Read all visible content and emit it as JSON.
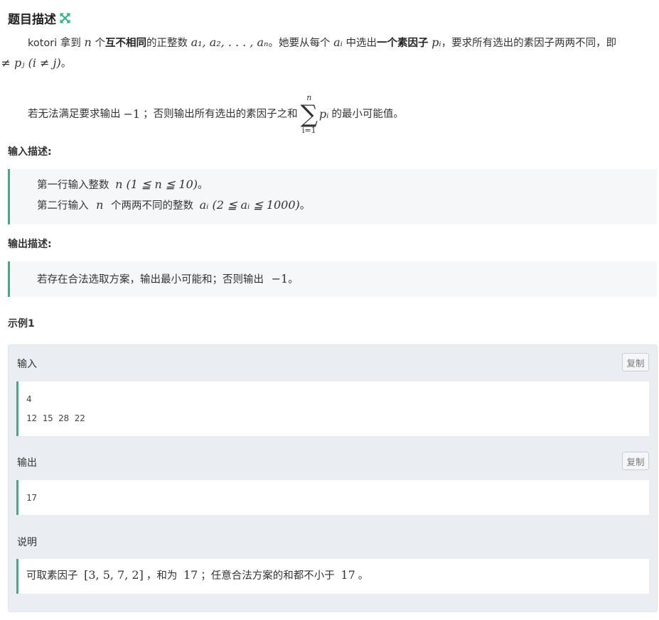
{
  "header": {
    "title": "题目描述",
    "icon": "expand-icon",
    "accent": "#2fb485"
  },
  "description": {
    "p1_intro": "kotori 拿到",
    "p1_n": "n",
    "p1_ge": " 个",
    "p1_bold1": "互不相同",
    "p1_mid": "的正整数",
    "p1_seq": "a₁, a₂, . . . , aₙ",
    "p1_after": "。她要从每个",
    "p1_ai": "aᵢ",
    "p1_mid2": " 中选出",
    "p1_bold2": "一个素因子",
    "p1_pi": "pᵢ",
    "p1_tail": "，要求所有选出的素因子两两不同，即",
    "p1_cond": "pᵢ ≠ pⱼ (i ≠ j)",
    "p1_end": "。",
    "p2_pre": "若无法满足要求输出",
    "p2_neg1": "−1",
    "p2_mid": "；否则输出所有选出的素因子之和",
    "sum_upper": "n",
    "sum_sigma": "∑",
    "sum_lower": "i=1",
    "sum_term": "pᵢ",
    "p2_end": "的最小可能值。"
  },
  "input_desc": {
    "label": "输入描述:",
    "line1_text": "第一行输入整数",
    "line1_math": "n (1 ≦ n ≦ 10)",
    "line1_end": "。",
    "line2_text": "第二行输入",
    "line2_n": "n",
    "line2_text2": "个两两不同的整数",
    "line2_math": "aᵢ (2 ≦ aᵢ ≦ 1000)",
    "line2_end": "。"
  },
  "output_desc": {
    "label": "输出描述:",
    "text": "若存在合法选取方案，输出最小可能和；否则输出",
    "math": "−1",
    "end": "。"
  },
  "example": {
    "heading": "示例1",
    "input_label": "输入",
    "input_lines": [
      "4",
      "12 15 28 22"
    ],
    "output_label": "输出",
    "output_lines": [
      "17"
    ],
    "copy_label": "复制",
    "explain_label": "说明",
    "explain_pre": "可取素因子",
    "explain_set": "[3, 5, 7, 2]",
    "explain_mid": "，和为",
    "explain_val": "17",
    "explain_mid2": "；任意合法方案的和都不小于",
    "explain_val2": "17",
    "explain_end": "。"
  }
}
